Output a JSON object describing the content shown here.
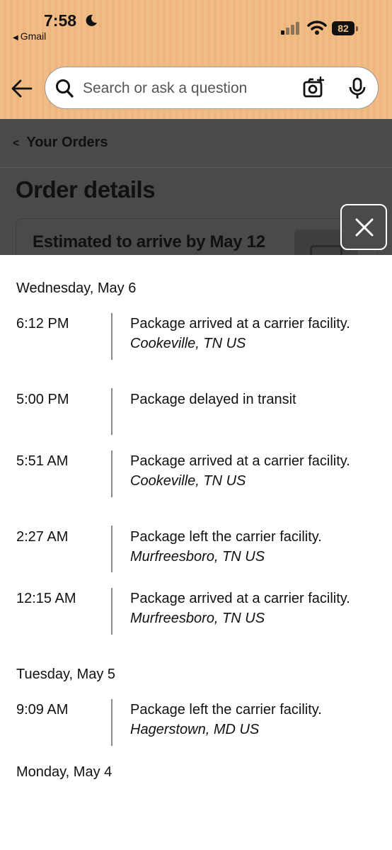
{
  "status_bar": {
    "time": "7:58",
    "back_app": "Gmail",
    "battery": "82"
  },
  "search": {
    "placeholder": "Search or ask a question"
  },
  "nav": {
    "breadcrumb": "Your Orders",
    "page_title": "Order details",
    "estimate": "Estimated to arrive by May 12"
  },
  "tracking": {
    "days": [
      {
        "label": "Wednesday, May 6",
        "events": [
          {
            "time": "6:12 PM",
            "description": "Package arrived at a carrier facility.",
            "location": "Cookeville, TN US"
          },
          {
            "time": "5:00 PM",
            "description": "Package delayed in transit",
            "location": ""
          },
          {
            "time": "5:51 AM",
            "description": "Package arrived at a carrier facility.",
            "location": "Cookeville, TN US"
          },
          {
            "time": "2:27 AM",
            "description": "Package left the carrier facility.",
            "location": "Murfreesboro, TN US"
          },
          {
            "time": "12:15 AM",
            "description": "Package arrived at a carrier facility.",
            "location": "Murfreesboro, TN US"
          }
        ]
      },
      {
        "label": "Tuesday, May 5",
        "events": [
          {
            "time": "9:09 AM",
            "description": "Package left the carrier facility.",
            "location": "Hagerstown, MD US"
          }
        ]
      },
      {
        "label": "Monday, May 4",
        "events": []
      }
    ]
  },
  "colors": {
    "header_bg": "#f1bd86",
    "overlay": "#4a4a4a",
    "timeline_line": "#8a8a8a"
  },
  "icons": [
    "moon-icon",
    "signal-icon",
    "wifi-icon",
    "back-arrow-icon",
    "search-icon",
    "camera-icon",
    "mic-icon",
    "chevron-left-icon",
    "close-icon"
  ]
}
